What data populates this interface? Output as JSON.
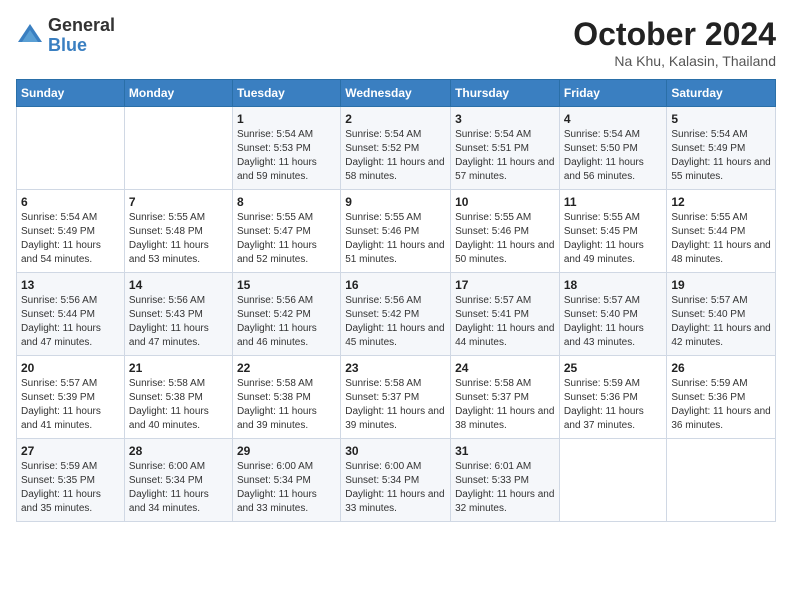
{
  "logo": {
    "general": "General",
    "blue": "Blue"
  },
  "title": "October 2024",
  "subtitle": "Na Khu, Kalasin, Thailand",
  "header_days": [
    "Sunday",
    "Monday",
    "Tuesday",
    "Wednesday",
    "Thursday",
    "Friday",
    "Saturday"
  ],
  "weeks": [
    [
      {
        "day": "",
        "info": ""
      },
      {
        "day": "",
        "info": ""
      },
      {
        "day": "1",
        "info": "Sunrise: 5:54 AM\nSunset: 5:53 PM\nDaylight: 11 hours and 59 minutes."
      },
      {
        "day": "2",
        "info": "Sunrise: 5:54 AM\nSunset: 5:52 PM\nDaylight: 11 hours and 58 minutes."
      },
      {
        "day": "3",
        "info": "Sunrise: 5:54 AM\nSunset: 5:51 PM\nDaylight: 11 hours and 57 minutes."
      },
      {
        "day": "4",
        "info": "Sunrise: 5:54 AM\nSunset: 5:50 PM\nDaylight: 11 hours and 56 minutes."
      },
      {
        "day": "5",
        "info": "Sunrise: 5:54 AM\nSunset: 5:49 PM\nDaylight: 11 hours and 55 minutes."
      }
    ],
    [
      {
        "day": "6",
        "info": "Sunrise: 5:54 AM\nSunset: 5:49 PM\nDaylight: 11 hours and 54 minutes."
      },
      {
        "day": "7",
        "info": "Sunrise: 5:55 AM\nSunset: 5:48 PM\nDaylight: 11 hours and 53 minutes."
      },
      {
        "day": "8",
        "info": "Sunrise: 5:55 AM\nSunset: 5:47 PM\nDaylight: 11 hours and 52 minutes."
      },
      {
        "day": "9",
        "info": "Sunrise: 5:55 AM\nSunset: 5:46 PM\nDaylight: 11 hours and 51 minutes."
      },
      {
        "day": "10",
        "info": "Sunrise: 5:55 AM\nSunset: 5:46 PM\nDaylight: 11 hours and 50 minutes."
      },
      {
        "day": "11",
        "info": "Sunrise: 5:55 AM\nSunset: 5:45 PM\nDaylight: 11 hours and 49 minutes."
      },
      {
        "day": "12",
        "info": "Sunrise: 5:55 AM\nSunset: 5:44 PM\nDaylight: 11 hours and 48 minutes."
      }
    ],
    [
      {
        "day": "13",
        "info": "Sunrise: 5:56 AM\nSunset: 5:44 PM\nDaylight: 11 hours and 47 minutes."
      },
      {
        "day": "14",
        "info": "Sunrise: 5:56 AM\nSunset: 5:43 PM\nDaylight: 11 hours and 47 minutes."
      },
      {
        "day": "15",
        "info": "Sunrise: 5:56 AM\nSunset: 5:42 PM\nDaylight: 11 hours and 46 minutes."
      },
      {
        "day": "16",
        "info": "Sunrise: 5:56 AM\nSunset: 5:42 PM\nDaylight: 11 hours and 45 minutes."
      },
      {
        "day": "17",
        "info": "Sunrise: 5:57 AM\nSunset: 5:41 PM\nDaylight: 11 hours and 44 minutes."
      },
      {
        "day": "18",
        "info": "Sunrise: 5:57 AM\nSunset: 5:40 PM\nDaylight: 11 hours and 43 minutes."
      },
      {
        "day": "19",
        "info": "Sunrise: 5:57 AM\nSunset: 5:40 PM\nDaylight: 11 hours and 42 minutes."
      }
    ],
    [
      {
        "day": "20",
        "info": "Sunrise: 5:57 AM\nSunset: 5:39 PM\nDaylight: 11 hours and 41 minutes."
      },
      {
        "day": "21",
        "info": "Sunrise: 5:58 AM\nSunset: 5:38 PM\nDaylight: 11 hours and 40 minutes."
      },
      {
        "day": "22",
        "info": "Sunrise: 5:58 AM\nSunset: 5:38 PM\nDaylight: 11 hours and 39 minutes."
      },
      {
        "day": "23",
        "info": "Sunrise: 5:58 AM\nSunset: 5:37 PM\nDaylight: 11 hours and 39 minutes."
      },
      {
        "day": "24",
        "info": "Sunrise: 5:58 AM\nSunset: 5:37 PM\nDaylight: 11 hours and 38 minutes."
      },
      {
        "day": "25",
        "info": "Sunrise: 5:59 AM\nSunset: 5:36 PM\nDaylight: 11 hours and 37 minutes."
      },
      {
        "day": "26",
        "info": "Sunrise: 5:59 AM\nSunset: 5:36 PM\nDaylight: 11 hours and 36 minutes."
      }
    ],
    [
      {
        "day": "27",
        "info": "Sunrise: 5:59 AM\nSunset: 5:35 PM\nDaylight: 11 hours and 35 minutes."
      },
      {
        "day": "28",
        "info": "Sunrise: 6:00 AM\nSunset: 5:34 PM\nDaylight: 11 hours and 34 minutes."
      },
      {
        "day": "29",
        "info": "Sunrise: 6:00 AM\nSunset: 5:34 PM\nDaylight: 11 hours and 33 minutes."
      },
      {
        "day": "30",
        "info": "Sunrise: 6:00 AM\nSunset: 5:34 PM\nDaylight: 11 hours and 33 minutes."
      },
      {
        "day": "31",
        "info": "Sunrise: 6:01 AM\nSunset: 5:33 PM\nDaylight: 11 hours and 32 minutes."
      },
      {
        "day": "",
        "info": ""
      },
      {
        "day": "",
        "info": ""
      }
    ]
  ]
}
